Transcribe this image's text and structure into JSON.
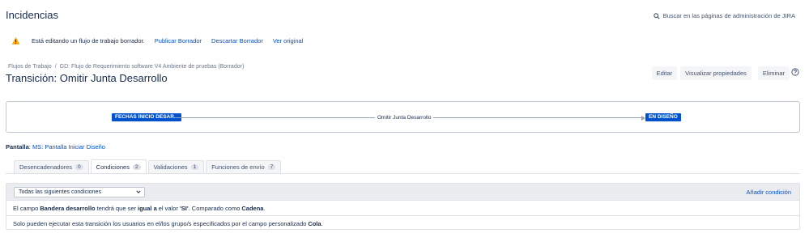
{
  "header": {
    "title": "Incidencias",
    "admin_search": "Buscar en las páginas de administración de JIRA"
  },
  "draft_notice": {
    "text": "Está editando un flujo de trabajo borrador.",
    "publish": "Publicar Borrador",
    "discard": "Descartar Borrador",
    "view_original": "Ver original"
  },
  "breadcrumb": {
    "root": "Flujos de Trabajo",
    "separator": "/",
    "current": "GD: Flujo de Requerimiento software V4 Ambiente de pruebas (Borrador)"
  },
  "page_title": "Transición: Omitir Junta Desarrollo",
  "actions": {
    "edit": "Editar",
    "properties": "Visualizar propiedades",
    "delete": "Eliminar"
  },
  "diagram": {
    "from_status": "FECHAS INICIO DESAR...",
    "transition": "Omitir Junta Desarrollo",
    "to_status": "EN DISEÑO",
    "status_color": "#0052cc"
  },
  "screen": {
    "label": "Pantalla",
    "value": "MS: Pantalla Iniciar Diseño"
  },
  "tabs": [
    {
      "label": "Desencadenadores",
      "count": "0"
    },
    {
      "label": "Condiciones",
      "count": "2"
    },
    {
      "label": "Validaciones",
      "count": "1"
    },
    {
      "label": "Funciones de envío",
      "count": "7"
    }
  ],
  "conditions": {
    "select_value": "Todas las siguientes condiciones",
    "add_label": "Añadir condición",
    "row1": {
      "p1": "El campo",
      "field": "Bandera desarrollo",
      "p2": "tendrá que ser",
      "op": "igual a",
      "p3": "el valor",
      "value": "'SI'",
      "p4": ". Comparado como",
      "type": "Cadena",
      "end": "."
    },
    "row2": {
      "text": "Solo pueden ejecutar esta transición los usuarios en el/los grupo/s especificados por el campo personalizado",
      "field": "Cola",
      "end": "."
    }
  },
  "colors": {
    "link": "#0052cc",
    "text": "#172b4d",
    "warning": "#ffab00"
  }
}
